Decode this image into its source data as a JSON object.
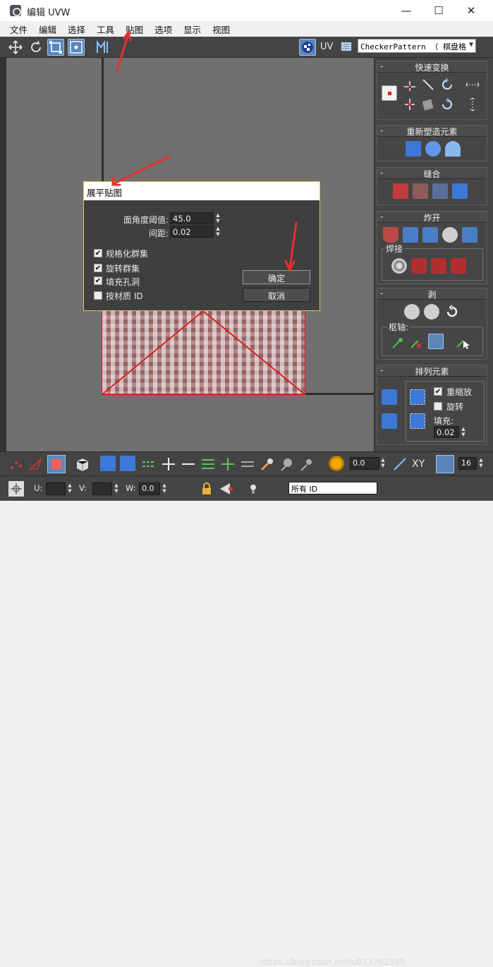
{
  "window": {
    "title": "编辑 UVW",
    "minimize": "—",
    "maximize": "☐",
    "close": "✕"
  },
  "menubar": [
    "文件",
    "编辑",
    "选择",
    "工具",
    "贴图",
    "选项",
    "显示",
    "视图"
  ],
  "toolbar": {
    "uv_label": "UV",
    "pattern_value": "CheckerPattern  （ 棋盘格"
  },
  "dialog": {
    "title": "展平贴图",
    "angle_label": "面角度阈值:",
    "angle_value": "45.0",
    "spacing_label": "间距:",
    "spacing_value": "0.02",
    "options": [
      {
        "label": "规格化群集",
        "checked": true
      },
      {
        "label": "旋转群集",
        "checked": true
      },
      {
        "label": "填充孔洞",
        "checked": true
      },
      {
        "label": "按材质 ID",
        "checked": false
      }
    ],
    "ok_label": "确定",
    "cancel_label": "取消"
  },
  "rollouts": {
    "quick_transform": "快速变换",
    "reshape": "重新塑造元素",
    "stitch": "缝合",
    "explode": "炸开",
    "weld": "焊接",
    "peel": "剥",
    "pivot": "枢轴:",
    "arrange": "排列元素",
    "rescale_label": "重缩放",
    "rescale_checked": true,
    "rotate_label": "旋转",
    "rotate_checked": false,
    "padding_label": "填充:",
    "padding_value": "0.02"
  },
  "bottom": {
    "field1_value": "0.0",
    "xy_label": "XY",
    "grid_value": "16",
    "u_label": "U:",
    "v_label": "V:",
    "w_label": "W:",
    "w_value": "0.0",
    "id_select": "所有 ID",
    "watermark": "https://blog.csdn.net/u013762365"
  },
  "colors": {
    "accent_blue": "#5b87b8",
    "panel_bg": "#444444",
    "viewport_bg": "#707070",
    "uv_edge_red": "#cc2222",
    "annotation_red": "#e53030"
  }
}
